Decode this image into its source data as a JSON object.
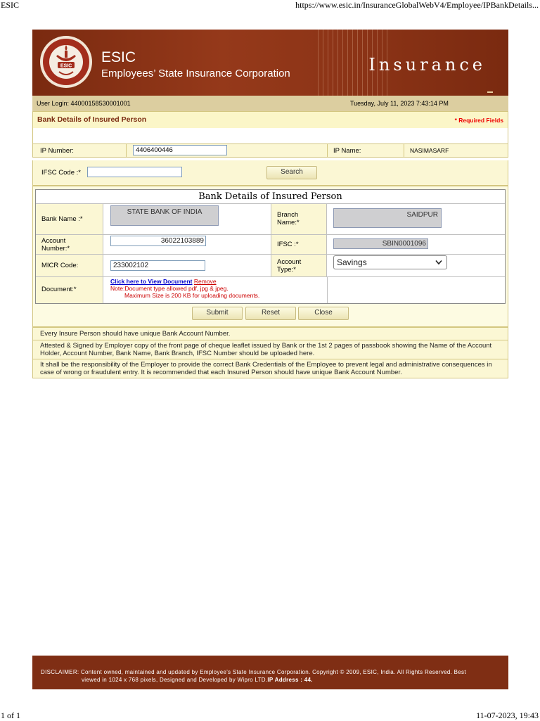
{
  "print": {
    "title": "ESIC",
    "url": "https://www.esic.in/InsuranceGlobalWebV4/Employee/IPBankDetails...",
    "page": "1 of 1",
    "datetime": "11-07-2023, 19:43"
  },
  "banner": {
    "logo_text": "ESIC",
    "title": "ESIC",
    "subtitle": "Employees’ State Insurance Corporation",
    "module": "Insurance"
  },
  "login": {
    "user": "User Login:  44000158530001001",
    "date": "Tuesday, July 11, 2023 7:43:14 PM"
  },
  "section": {
    "title": "Bank Details of Insured Person",
    "required": "* Required Fields"
  },
  "ip": {
    "number_label": "IP Number:",
    "number_value": "4406400446",
    "name_label": "IP Name:",
    "name_value": "NASIMASARF"
  },
  "ifsc_search": {
    "label": "IFSC Code :*",
    "value": "",
    "button": "Search"
  },
  "form": {
    "heading": "Bank Details of Insured Person",
    "bank_name_label": "Bank Name :*",
    "bank_name_value": "STATE BANK OF INDIA",
    "branch_label": "Branch Name:*",
    "branch_value": "SAIDPUR",
    "account_label": "Account Number:*",
    "account_value": "36022103889",
    "ifsc_label": "IFSC :*",
    "ifsc_value": "SBIN0001096",
    "micr_label": "MICR Code:",
    "micr_value": "233002102",
    "account_type_label": "Account Type:*",
    "account_type_value": "Savings",
    "document_label": "Document:*",
    "view_doc_link": "Click here to View Document",
    "remove_link": "Remove",
    "doc_note": "Note:Document type allowed pdf, jpg & jpeg.",
    "doc_size_note": "Maximum Size is 200 KB for uploading documents."
  },
  "actions": {
    "submit": "Submit",
    "reset": "Reset",
    "close": "Close"
  },
  "notes": [
    "Every Insure Person should have unique Bank Account Number.",
    "Attested & Signed by Employer copy of the front page of cheque leaflet issued by Bank or the 1st 2 pages of passbook showing the Name of the Account Holder, Account Number, Bank Name, Bank Branch, IFSC Number should be uploaded here.",
    "It shall be the responsibility of the Employer to provide the correct Bank Credentials of the Employee to prevent legal and administrative consequences in case of wrong or fraudulent entry. It is recommended that each Insured Person should have unique Bank Account Number."
  ],
  "disclaimer": {
    "line1": "DISCLAIMER: Content owned, maintained and updated by Employee's State Insurance Corporation. Copyright © 2009, ESIC, India. All Rights Reserved. Best",
    "line2": "viewed in 1024 x 768 pixels, Designed and Developed by Wipro LTD.",
    "ip_label": "IP Address : 44."
  },
  "colors": {
    "banner": "#8b3316",
    "panel": "#fbf7d4",
    "required": "#ee0000",
    "link": "#0000cc"
  }
}
